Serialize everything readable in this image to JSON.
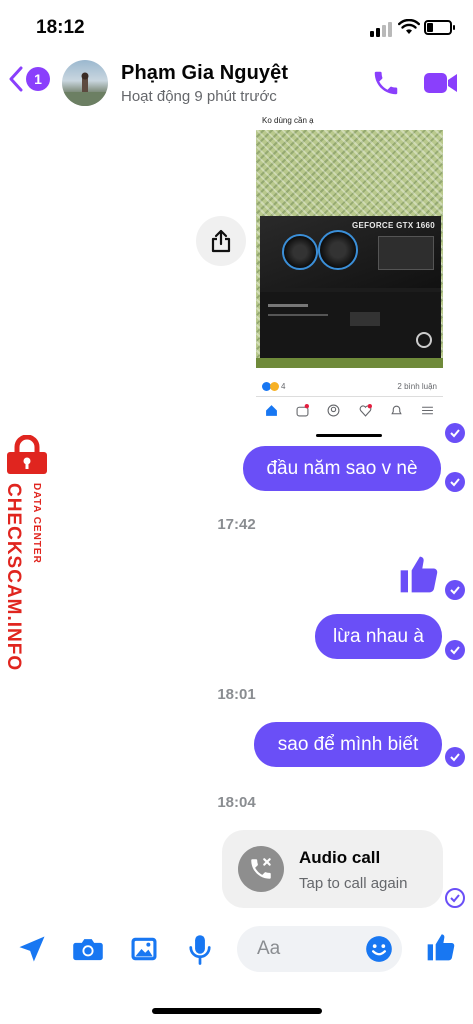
{
  "status_bar": {
    "time": "18:12",
    "battery_level": 0.25
  },
  "header": {
    "back_badge": "1",
    "contact_name": "Phạm Gia Nguyệt",
    "contact_status": "Hoạt động 9 phút trước"
  },
  "shared_post": {
    "caption": "Ko dùng cần ạ",
    "product_label": "GEFORCE GTX 1660",
    "reaction_count": "4",
    "comments": "2 bình luận"
  },
  "messages": [
    {
      "type": "text",
      "text": "đầu năm sao v nè",
      "read": true
    },
    {
      "type": "timestamp",
      "text": "17:42"
    },
    {
      "type": "like",
      "read": true
    },
    {
      "type": "text",
      "text": "lừa nhau à",
      "read": true
    },
    {
      "type": "timestamp",
      "text": "18:01"
    },
    {
      "type": "text",
      "text": "sao để mình biết",
      "read": true
    },
    {
      "type": "timestamp",
      "text": "18:04"
    },
    {
      "type": "call",
      "title": "Audio call",
      "subtitle": "Tap to call again"
    }
  ],
  "composer": {
    "placeholder": "Aa"
  },
  "watermark": {
    "brand": "CHECKSCAM.INFO",
    "sub": "DATA CENTER"
  },
  "colors": {
    "accent": "#6a4ff7",
    "header_icons": "#8a3ffc",
    "composer_icons": "#1877f2",
    "watermark": "#e0251f"
  },
  "icons": [
    "chevron-left-icon",
    "phone-icon",
    "video-camera-icon",
    "share-icon",
    "thumbs-up-icon",
    "missed-call-icon",
    "location-arrow-icon",
    "camera-icon",
    "image-icon",
    "microphone-icon",
    "smiley-icon"
  ]
}
